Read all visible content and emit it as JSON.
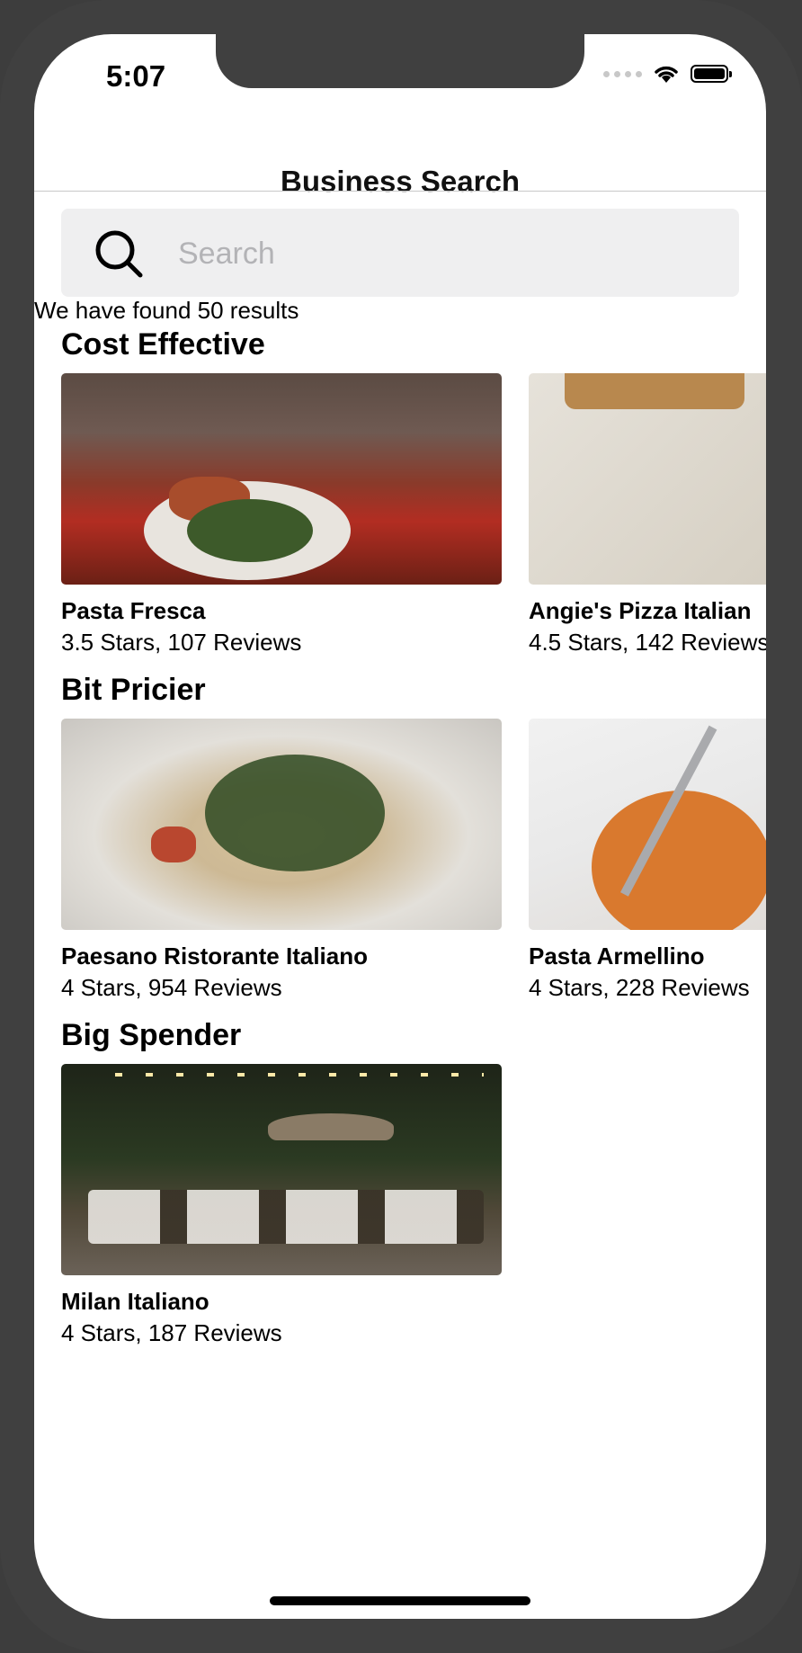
{
  "status_bar": {
    "time": "5:07"
  },
  "nav": {
    "title": "Business Search"
  },
  "search": {
    "placeholder": "Search",
    "value": ""
  },
  "results": {
    "summary": "We have found 50 results"
  },
  "sections": [
    {
      "title": "Cost Effective",
      "items": [
        {
          "name": "Pasta Fresca",
          "meta": "3.5 Stars, 107 Reviews"
        },
        {
          "name": "Angie's Pizza Italian",
          "meta": "4.5 Stars, 142 Reviews"
        }
      ]
    },
    {
      "title": "Bit Pricier",
      "items": [
        {
          "name": "Paesano Ristorante Italiano",
          "meta": "4 Stars, 954 Reviews"
        },
        {
          "name": "Pasta Armellino",
          "meta": "4 Stars, 228 Reviews"
        }
      ]
    },
    {
      "title": "Big Spender",
      "items": [
        {
          "name": "Milan Italiano",
          "meta": "4 Stars, 187 Reviews"
        }
      ]
    }
  ],
  "colors": {
    "device_frame": "#404040",
    "search_background": "#efeff0",
    "placeholder": "#b3b3b6"
  },
  "icons": {
    "search": "search-icon",
    "wifi": "wifi-icon",
    "battery": "battery-icon"
  }
}
